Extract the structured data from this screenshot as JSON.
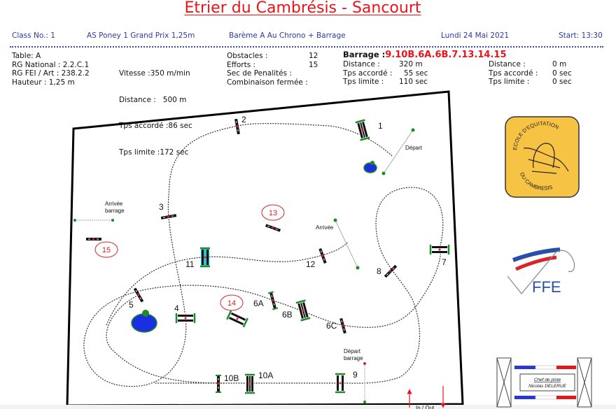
{
  "title": "Etrier du Cambrésis - Sancourt",
  "class_bar": {
    "class_no": "Class No.: 1",
    "class_name": "AS Poney 1 Grand Prix 1,25m",
    "bareme": "Barème A Au Chrono + Barrage",
    "date": "Lundi 24 Mai 2021",
    "start": "Start: 13:30"
  },
  "info": {
    "col1": [
      "Table: A",
      "RG National : 2.2.C.1",
      "RG FEI / Art : 238.2.2",
      "Hauteur : 1,25 m"
    ],
    "col2": [
      "Vitesse :350 m/min",
      "Distance :   500 m",
      "Tps accordé :86 sec",
      "Tps limite :172 sec"
    ],
    "col3": [
      {
        "label": "Obstacles :",
        "value": "12"
      },
      {
        "label": "Efforts :",
        "value": "15"
      },
      {
        "label": "Sec de Penalités :",
        "value": ""
      },
      {
        "label": "Combinaison fermée :",
        "value": ""
      }
    ],
    "barrage": {
      "label": "Barrage :",
      "sequence": "9.10B.6A.6B.7.13.14.15",
      "rows": [
        {
          "label": "Distance :",
          "value": "320 m"
        },
        {
          "label": "Tps accordé :",
          "value": "55 sec"
        },
        {
          "label": "Tps limite :",
          "value": "110 sec"
        }
      ]
    },
    "col5": [
      {
        "label": "Distance :",
        "value": "0 m"
      },
      {
        "label": "Tps accordé :",
        "value": "0 sec"
      },
      {
        "label": "Tps limite :",
        "value": "0 sec"
      }
    ]
  },
  "course": {
    "obstacles": [
      {
        "id": "1",
        "type": "oxer"
      },
      {
        "id": "2",
        "type": "vertical"
      },
      {
        "id": "3",
        "type": "vertical"
      },
      {
        "id": "4",
        "type": "oxer"
      },
      {
        "id": "5",
        "type": "vertical"
      },
      {
        "id": "6A",
        "type": "vertical"
      },
      {
        "id": "6B",
        "type": "oxer"
      },
      {
        "id": "6C",
        "type": "vertical"
      },
      {
        "id": "7",
        "type": "oxer"
      },
      {
        "id": "8",
        "type": "vertical"
      },
      {
        "id": "9",
        "type": "oxer"
      },
      {
        "id": "10A",
        "type": "oxer"
      },
      {
        "id": "10B",
        "type": "vertical"
      },
      {
        "id": "11",
        "type": "water-oxer"
      },
      {
        "id": "12",
        "type": "vertical"
      }
    ],
    "barrage_obstacles": [
      "13",
      "14",
      "15"
    ],
    "labels": {
      "depart": "Départ",
      "arrivee": "Arrivée",
      "arrivee_barrage_1": "Arrivée",
      "arrivee_barrage_2": "barrage",
      "depart_barrage_1": "Départ",
      "depart_barrage_2": "barrage",
      "in_out": "In / Out"
    },
    "colors": {
      "path": "#333333",
      "standards": "#1e8a2a",
      "water": "#20c8dc",
      "pond": "#1a2fe0",
      "barrage_ring": "#d6242a",
      "arrow": "#e8141a"
    }
  },
  "logos": {
    "club_top": "ECOLE D'EQUITATION",
    "club_bottom": "DU CAMBRESIS",
    "ffe": "FFE",
    "designer_title": "Chef de piste",
    "designer_name": "Nicolas DELERUE"
  }
}
